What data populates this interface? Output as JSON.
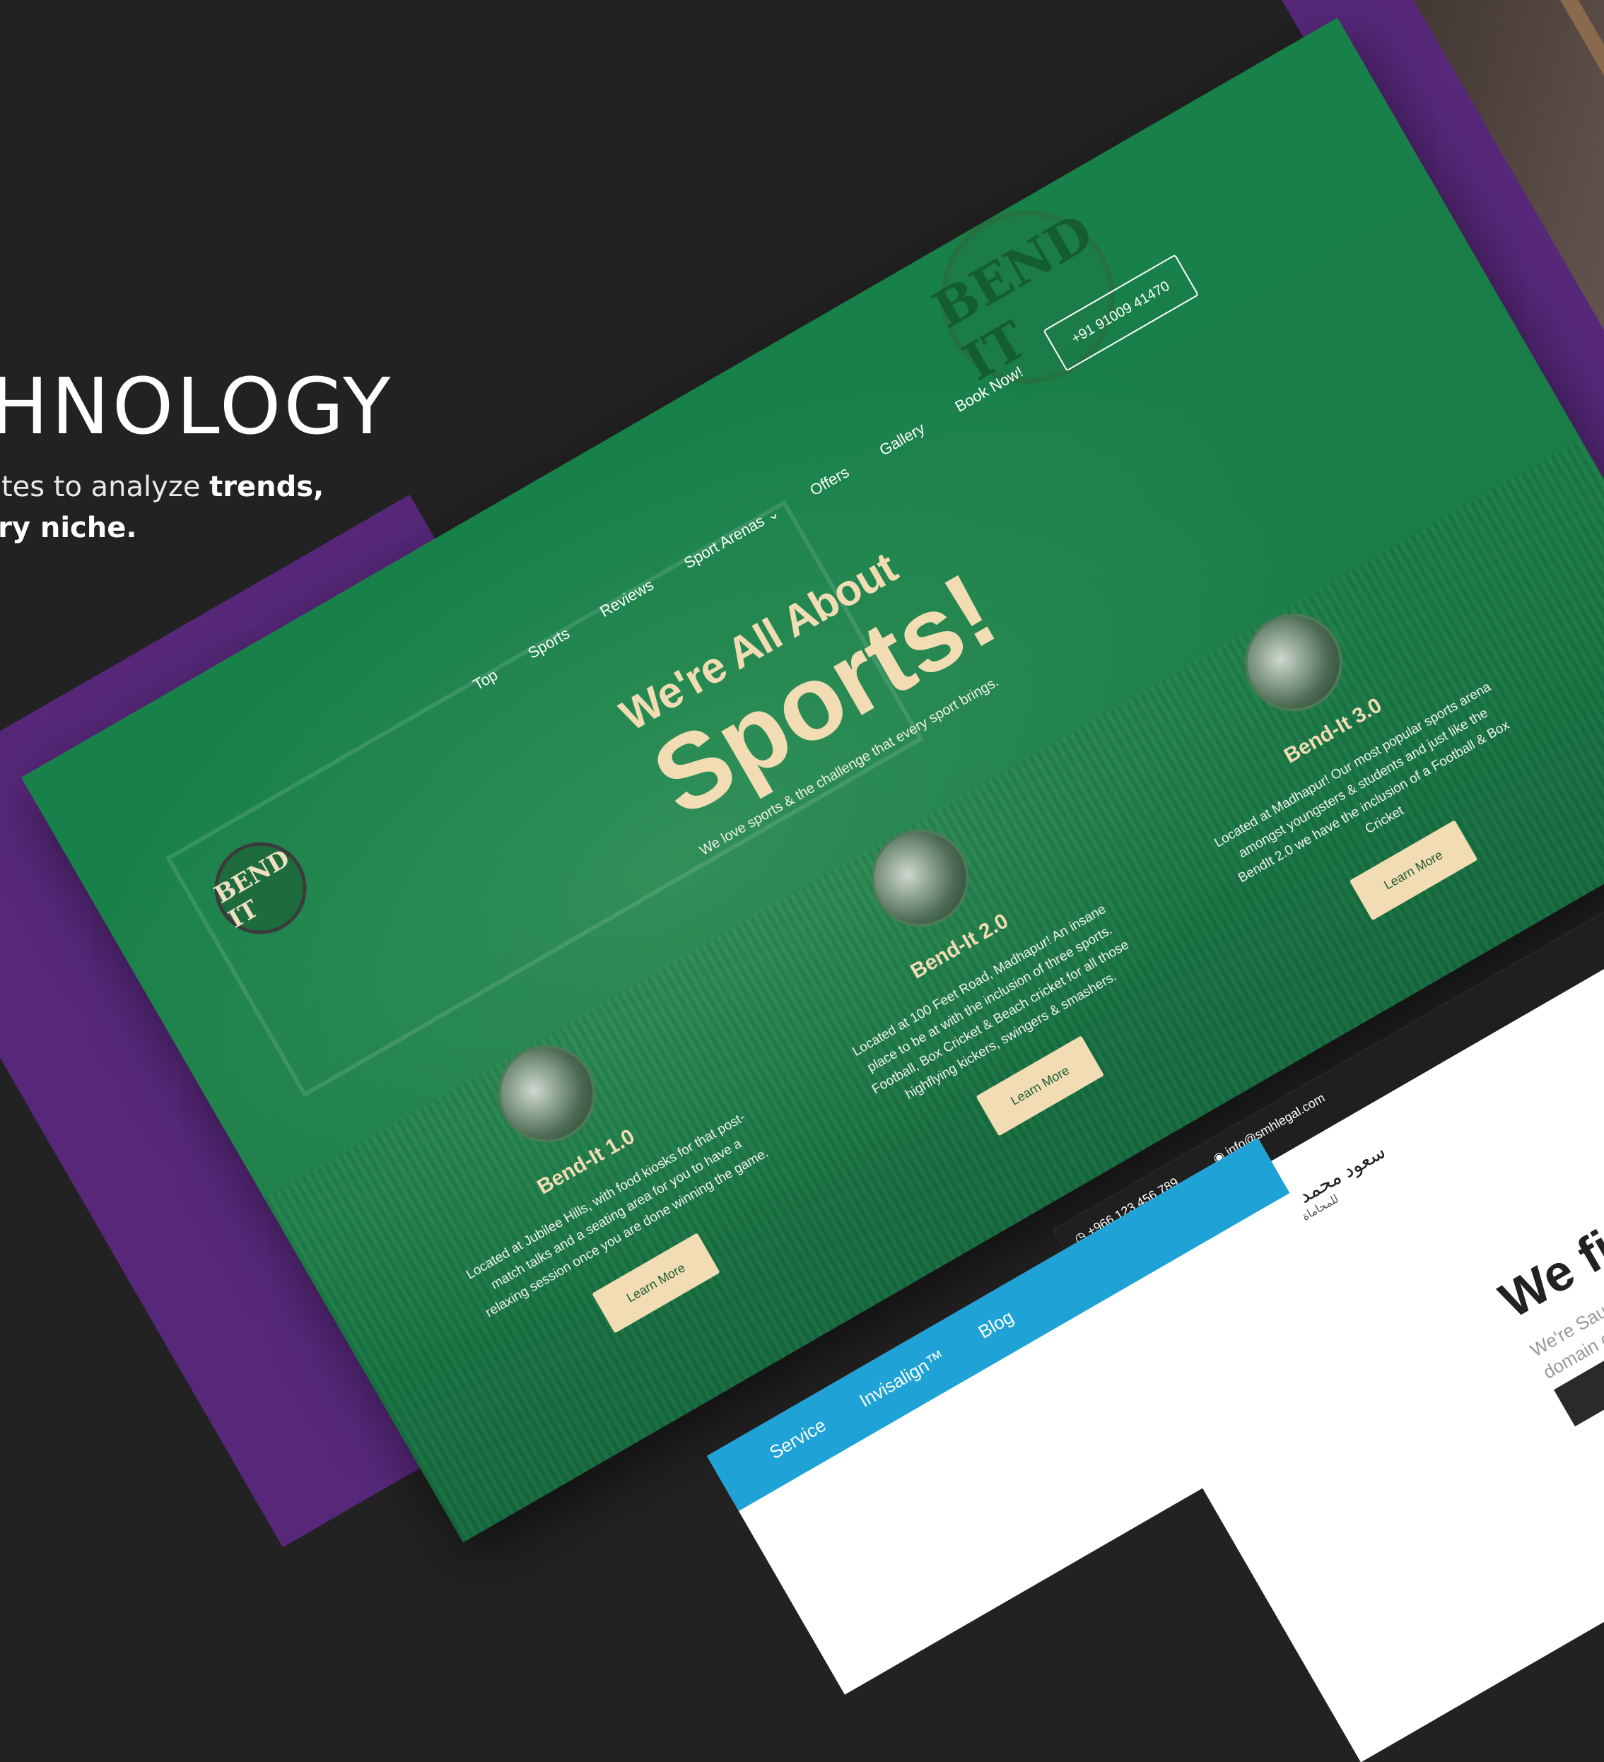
{
  "hero": {
    "title": "CHNOLOGY",
    "sub_line1_start": "sites to analyze ",
    "sub_line1_bold": "trends,",
    "sub_line2": "ery niche."
  },
  "bendit": {
    "watermark_logo": "BEND IT",
    "small_logo": "BEND IT",
    "nav": [
      "Top",
      "Sports",
      "Reviews",
      "Sport Arenas ⌄",
      "Offers",
      "Gallery",
      "Book Now!"
    ],
    "phone": "+91 91009 41470",
    "headline_small": "We're All About",
    "headline_big": "Sports!",
    "tagline": "We love sports & the challenge that every sport brings.",
    "cards": [
      {
        "name": "Bend-It 1.0",
        "desc": "Located at Jubilee Hills, with food kiosks for that post-match talks and a seating area for you to have a relaxing session once you are done winning the game.",
        "button": "Learn More"
      },
      {
        "name": "Bend-It 2.0",
        "desc": "Located at 100 Feet Road, Madhapur! An insane place to be at with the inclusion of three sports. Football, Box Cricket & Beach cricket for all those highflying kickers, swingers & smashers.",
        "button": "Learn More"
      },
      {
        "name": "Bend-It 3.0",
        "desc": "Located at Madhapur! Our most popular sports arena amongst youngsters & students and just like the BendIt 2.0 we have the inclusion of a Football & Box Cricket",
        "button": "Learn More"
      }
    ]
  },
  "arabic_site": {
    "phone": "+966 123 456 789",
    "email": "info@smhlegal.com",
    "brand_name": "سعود محمد صالح الدريبي",
    "brand_sub": "للمحاماة والاستشارات القانونية",
    "headline": "We figh",
    "sub_line1": "We're Saud",
    "sub_line2": "domain c"
  },
  "blue_site": {
    "nav": [
      "Service",
      "Invisalign™",
      "Blog"
    ]
  },
  "colors": {
    "background": "#232223",
    "purple": "#57287a",
    "green": "#18814a",
    "cream": "#f1dcb3",
    "blue_bar": "#1fa3d6"
  }
}
